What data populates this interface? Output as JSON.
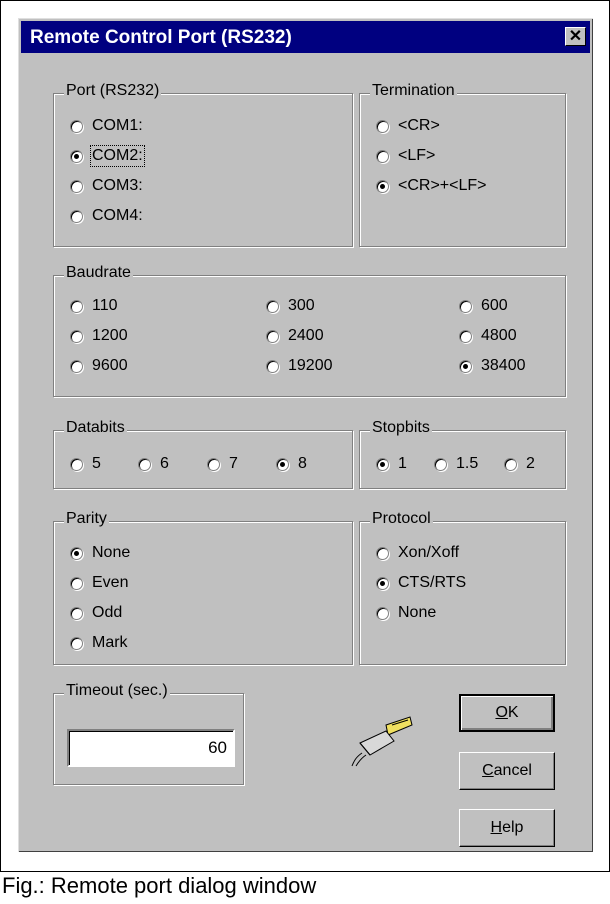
{
  "window": {
    "title": "Remote Control Port (RS232)",
    "close_glyph": "✕"
  },
  "port": {
    "legend": "Port (RS232)",
    "options": [
      "COM1:",
      "COM2:",
      "COM3:",
      "COM4:"
    ],
    "selected": "COM2:"
  },
  "termination": {
    "legend": "Termination",
    "options": [
      "<CR>",
      "<LF>",
      "<CR>+<LF>"
    ],
    "selected": "<CR>+<LF>"
  },
  "baudrate": {
    "legend": "Baudrate",
    "options": [
      "110",
      "300",
      "600",
      "1200",
      "2400",
      "4800",
      "9600",
      "19200",
      "38400"
    ],
    "selected": "38400"
  },
  "databits": {
    "legend": "Databits",
    "options": [
      "5",
      "6",
      "7",
      "8"
    ],
    "selected": "8"
  },
  "stopbits": {
    "legend": "Stopbits",
    "options": [
      "1",
      "1.5",
      "2"
    ],
    "selected": "1"
  },
  "parity": {
    "legend": "Parity",
    "options": [
      "None",
      "Even",
      "Odd",
      "Mark"
    ],
    "selected": "None"
  },
  "protocol": {
    "legend": "Protocol",
    "options": [
      "Xon/Xoff",
      "CTS/RTS",
      "None"
    ],
    "selected": "CTS/RTS"
  },
  "timeout": {
    "legend": "Timeout (sec.)",
    "value": "60"
  },
  "buttons": {
    "ok": {
      "accel": "O",
      "rest": "K"
    },
    "cancel": {
      "accel": "C",
      "rest": "ancel"
    },
    "help": {
      "accel": "H",
      "rest": "elp"
    }
  },
  "icons": {
    "connector": "serial-connector-icon"
  },
  "caption": "Fig.: Remote port dialog window"
}
